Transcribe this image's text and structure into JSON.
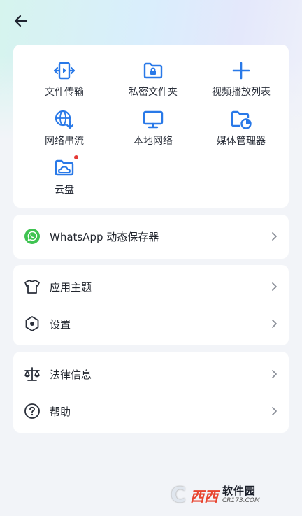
{
  "header": {
    "back_icon": "arrow-left-icon"
  },
  "colors": {
    "accent": "#2979e8",
    "whatsapp": "#3fc351",
    "card": "#ffffff",
    "background": "#f2f4f8"
  },
  "features": [
    {
      "label": "文件传输",
      "icon": "file-transfer-icon"
    },
    {
      "label": "私密文件夹",
      "icon": "private-folder-icon"
    },
    {
      "label": "视频播放列表",
      "icon": "plus-icon"
    },
    {
      "label": "网络串流",
      "icon": "network-stream-icon"
    },
    {
      "label": "本地网络",
      "icon": "monitor-icon"
    },
    {
      "label": "媒体管理器",
      "icon": "media-manager-icon"
    },
    {
      "label": "云盘",
      "icon": "cloud-folder-icon",
      "badge": "red-dot"
    }
  ],
  "whatsapp": {
    "label": "WhatsApp 动态保存器",
    "icon": "whatsapp-icon"
  },
  "group1": [
    {
      "label": "应用主题",
      "icon": "tshirt-icon"
    },
    {
      "label": "设置",
      "icon": "hexagon-settings-icon"
    }
  ],
  "group2": [
    {
      "label": "法律信息",
      "icon": "scale-icon"
    },
    {
      "label": "帮助",
      "icon": "help-circle-icon"
    }
  ],
  "watermark": {
    "logo_letter": "C",
    "brand": "西西",
    "name": "软件园",
    "url": "CR173.COM"
  }
}
